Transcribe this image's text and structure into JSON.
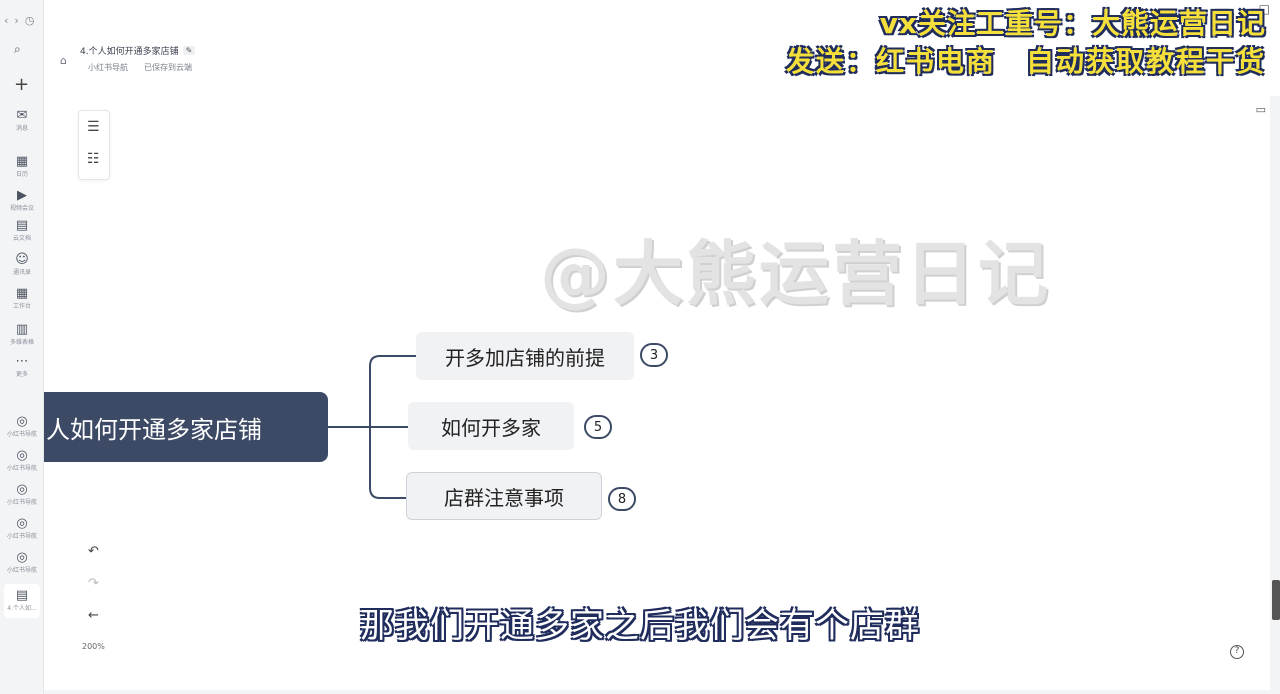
{
  "banner": {
    "line1": "vx关注工重号：大熊运营日记",
    "line2": "发送：红书电商　自动获取教程干货"
  },
  "doc": {
    "title": "4.个人如何开通多家店铺",
    "meta_left": "小红书导航",
    "meta_right": "已保存到云端"
  },
  "rail": {
    "items": [
      {
        "label": "消息",
        "icon": "message-icon"
      },
      {
        "label": "日历",
        "icon": "calendar-icon"
      },
      {
        "label": "视频会议",
        "icon": "video-icon"
      },
      {
        "label": "云文档",
        "icon": "doc-icon"
      },
      {
        "label": "通讯录",
        "icon": "contacts-icon"
      },
      {
        "label": "工作台",
        "icon": "workbench-icon"
      },
      {
        "label": "多维表格",
        "icon": "table-icon"
      },
      {
        "label": "更多",
        "icon": "more-icon"
      },
      {
        "label": "小红书导航",
        "icon": "nav-icon"
      },
      {
        "label": "小红书导航",
        "icon": "nav-icon"
      },
      {
        "label": "小红书导航",
        "icon": "nav-icon"
      },
      {
        "label": "小红书导航",
        "icon": "nav-icon"
      },
      {
        "label": "小红书导航",
        "icon": "nav-icon"
      },
      {
        "label": "4.个人如...",
        "icon": "doc-icon"
      }
    ]
  },
  "watermark": "@大熊运营日记",
  "mindmap": {
    "root": "人如何开通多家店铺",
    "children": [
      {
        "label": "开多加店铺的前提",
        "count": "3"
      },
      {
        "label": "如何开多家",
        "count": "5"
      },
      {
        "label": "店群注意事项",
        "count": "8"
      }
    ]
  },
  "zoom": "200%",
  "subtitle": "那我们开通多家之后我们会有个店群"
}
